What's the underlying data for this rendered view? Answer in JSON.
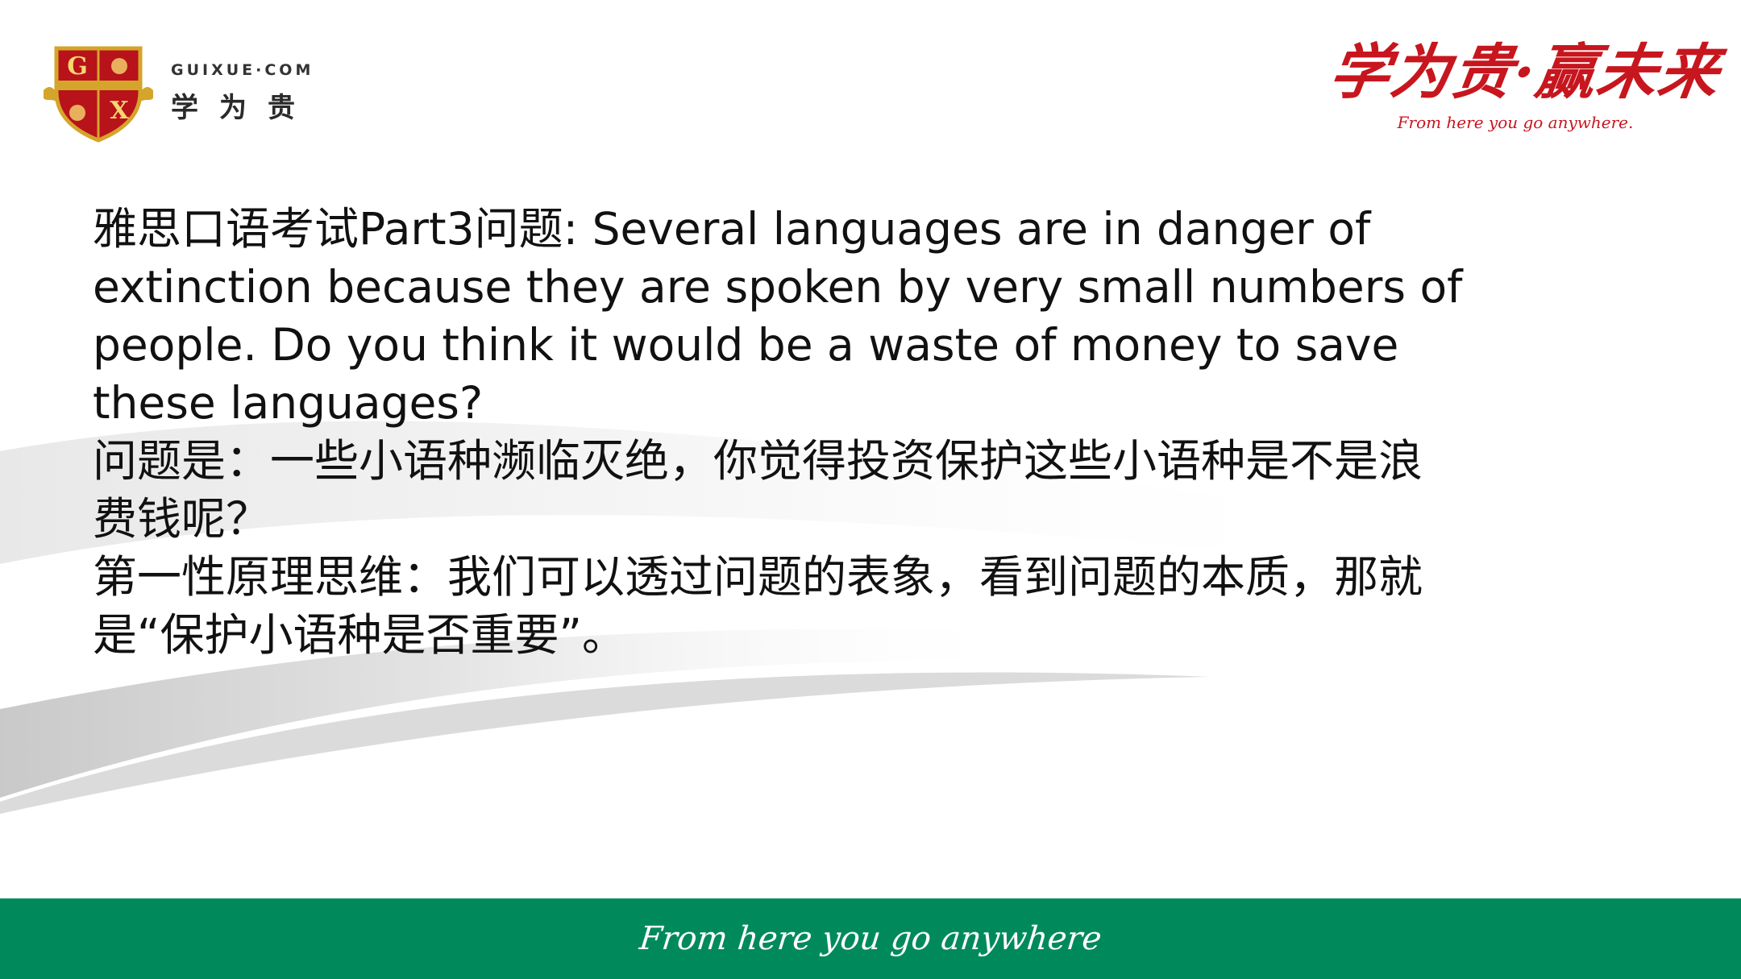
{
  "header": {
    "logo": {
      "site": "GUIXUE·COM",
      "cn_name": "学为贵",
      "shield_letters": [
        "G",
        "X"
      ]
    },
    "slogan": {
      "cn": "学为贵·赢未来",
      "en": "From here you go anywhere."
    }
  },
  "content": {
    "question_line": "雅思口语考试Part3问题: Several languages are in danger of extinction because they are spoken by very small numbers of people. Do you think it would be a waste of money to save these languages?",
    "translation_line": "问题是：一些小语种濒临灭绝，你觉得投资保护这些小语种是不是浪费钱呢？",
    "thinking_line": "第一性原理思维：我们可以透过问题的表象，看到问题的本质，那就是“保护小语种是否重要”。"
  },
  "footer": {
    "tagline": "From here you go anywhere"
  },
  "colors": {
    "brand_red": "#c7161e",
    "footer_green": "#008a5c",
    "text": "#111111"
  }
}
